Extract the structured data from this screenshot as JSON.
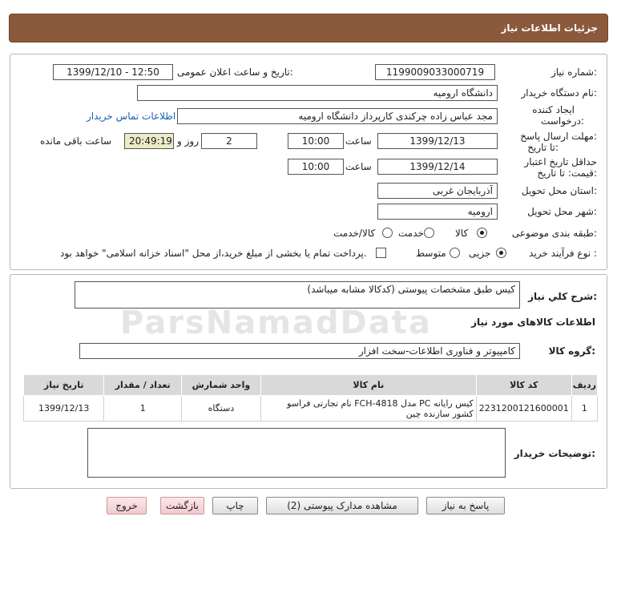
{
  "header": {
    "title": "جزئیات اطلاعات نیاز"
  },
  "form": {
    "need_number_label": "شماره نیاز:",
    "need_number": "1199009033000719",
    "announce_label": "تاریخ و ساعت اعلان عمومی:",
    "announce_value": "1399/12/10 - 12:50",
    "buyer_org_label": "نام دستگاه خریدار:",
    "buyer_org": "دانشگاه ارومیه",
    "creator_label_1": "ایجاد کننده",
    "creator_label_2": "درخواست:",
    "creator": "مجد  عباس زاده چرکندی کارپرداز دانشگاه ارومیه",
    "contact_link": "اطلاعات تماس خریدار",
    "deadline_label_1": "مهلت ارسال پاسخ:",
    "deadline_label_2": "تا تاریخ:",
    "deadline_date": "1399/12/13",
    "time_label": "ساعت",
    "deadline_time": "10:00",
    "days_value": "2",
    "days_label": "روز و",
    "remaining_time": "20:49:19",
    "remaining_label": "ساعت باقی مانده",
    "validity_label_1": "حداقل تاریخ اعتبار",
    "validity_label_2": "قیمت: تا تاریخ:",
    "validity_date": "1399/12/14",
    "validity_time": "10:00",
    "province_label": "استان محل تحویل:",
    "province": "آذربایجان غربی",
    "city_label": "شهر محل تحویل:",
    "city": "ارومیه",
    "category_label": "طبقه بندی موضوعی:",
    "category_options": [
      "کالا",
      "خدمت",
      "کالا/خدمت"
    ],
    "process_label": "نوع فرآیند خرید :",
    "process_options": [
      "جزیی",
      "متوسط"
    ],
    "payment_note": "پرداخت تمام یا بخشی از مبلغ خرید،از محل \"اسناد خزانه اسلامی\" خواهد بود."
  },
  "summary": {
    "desc_label": "شرح کلي نياز:",
    "desc": "کیس طبق مشخصات  پیوستی (کدکالا مشابه میباشد)",
    "items_heading": "اطلاعات کالاهای مورد نیاز",
    "group_label": "گروه کالا:",
    "group": "کامپیوتر و فناوری اطلاعات-سخت افزار",
    "table_headers": [
      "ردیف",
      "کد کالا",
      "نام کالا",
      "واحد شمارش",
      "تعداد / مقدار",
      "تاریخ نیاز"
    ],
    "rows": [
      {
        "row": "1",
        "code": "2231200121600001",
        "name": "کیس رایانه PC مدل FCH-4818 نام تجارتی فراسو کشور سازنده چین",
        "unit": "دستگاه",
        "qty": "1",
        "date": "1399/12/13"
      }
    ],
    "notes_label": "توضیحات خریدار:"
  },
  "buttons": {
    "reply": "پاسخ به نیاز",
    "attachments": "مشاهده مدارک پیوستی (2)",
    "print": "چاپ",
    "back": "بازگشت",
    "exit": "خروج"
  },
  "watermark": "ParsNamadData"
}
